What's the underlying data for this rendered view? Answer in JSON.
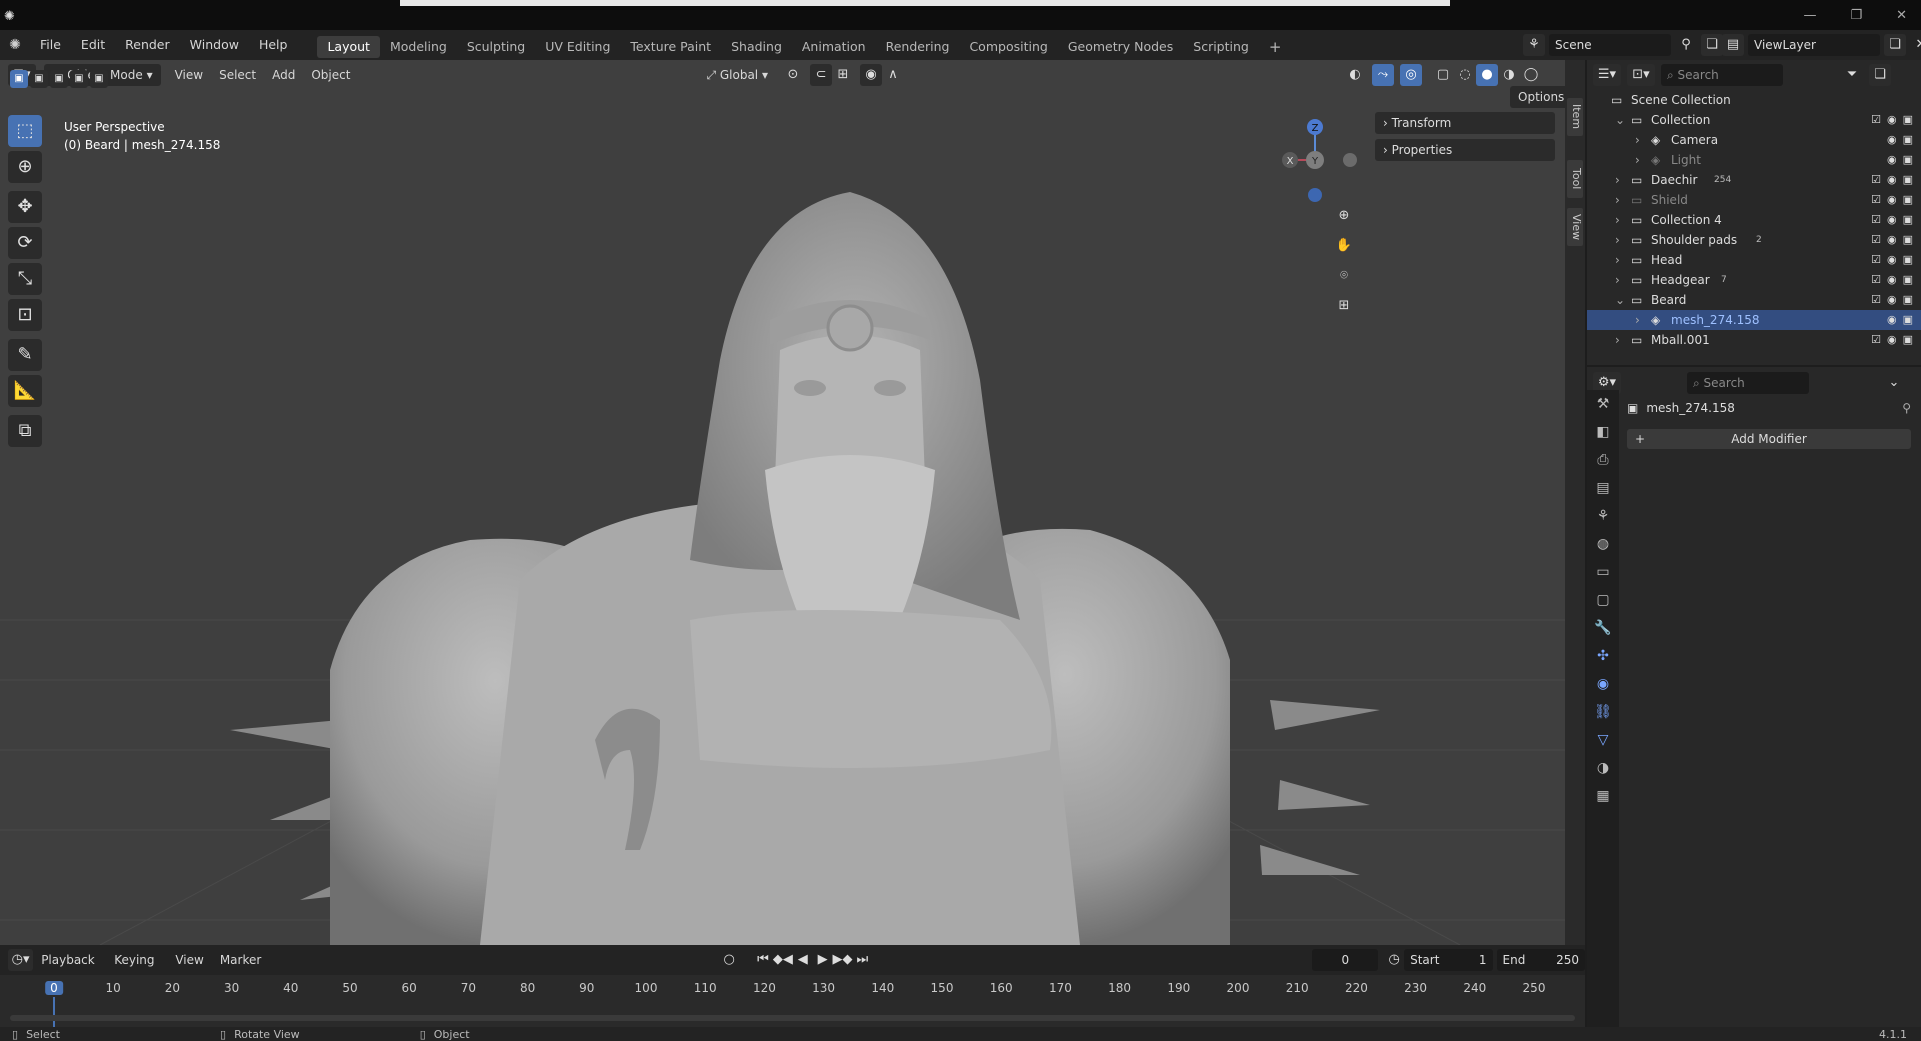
{
  "menu": {
    "items": [
      "File",
      "Edit",
      "Render",
      "Window",
      "Help"
    ],
    "workspaces": [
      "Layout",
      "Modeling",
      "Sculpting",
      "UV Editing",
      "Texture Paint",
      "Shading",
      "Animation",
      "Rendering",
      "Compositing",
      "Geometry Nodes",
      "Scripting"
    ],
    "active_workspace": "Layout",
    "add_workspace": "+",
    "scene": "Scene",
    "view_layer": "ViewLayer"
  },
  "viewport": {
    "mode": "Object Mode",
    "menus": [
      "View",
      "Select",
      "Add",
      "Object"
    ],
    "orientation": "Global",
    "options_label": "Options",
    "perspective": "User Perspective",
    "active_info": "(0) Beard | mesh_274.158",
    "gizmo": {
      "z": "Z",
      "x": "X",
      "y": "Y"
    },
    "npanel": {
      "transform": "Transform",
      "properties": "Properties"
    },
    "side_tabs": [
      "Item",
      "Tool",
      "View"
    ]
  },
  "outliner": {
    "search_placeholder": "Search",
    "rows": [
      {
        "label": "Scene Collection",
        "indent": 0
      },
      {
        "label": "Collection",
        "indent": 1
      },
      {
        "label": "Camera",
        "indent": 2
      },
      {
        "label": "Light",
        "indent": 2,
        "dim": true
      },
      {
        "label": "Daechir",
        "indent": 1,
        "badge": "254"
      },
      {
        "label": "Shield",
        "indent": 1,
        "dim": true
      },
      {
        "label": "Collection 4",
        "indent": 1
      },
      {
        "label": "Shoulder pads",
        "indent": 1,
        "badge": "2"
      },
      {
        "label": "Head",
        "indent": 1
      },
      {
        "label": "Headgear",
        "indent": 1,
        "badge": "7"
      },
      {
        "label": "Beard",
        "indent": 1
      },
      {
        "label": "mesh_274.158",
        "indent": 2,
        "selected": true
      },
      {
        "label": "Mball.001",
        "indent": 1
      }
    ]
  },
  "properties": {
    "search_placeholder": "Search",
    "object_name": "mesh_274.158",
    "add_modifier": "Add Modifier"
  },
  "timeline": {
    "menus": [
      "Playback",
      "Keying",
      "View",
      "Marker"
    ],
    "current_frame": "0",
    "start_label": "Start",
    "start_value": "1",
    "end_label": "End",
    "end_value": "250",
    "ticks": [
      "0",
      "10",
      "20",
      "30",
      "40",
      "50",
      "60",
      "70",
      "80",
      "90",
      "100",
      "110",
      "120",
      "130",
      "140",
      "150",
      "160",
      "170",
      "180",
      "190",
      "200",
      "210",
      "220",
      "230",
      "240",
      "250"
    ]
  },
  "status": {
    "select": "Select",
    "rotate": "Rotate View",
    "object": "Object",
    "version": "4.1.1"
  },
  "colors": {
    "accent": "#4772b3",
    "selected_row": "#334d80",
    "viewport_bg": "#3f3f3f",
    "panel_bg": "#282828"
  }
}
